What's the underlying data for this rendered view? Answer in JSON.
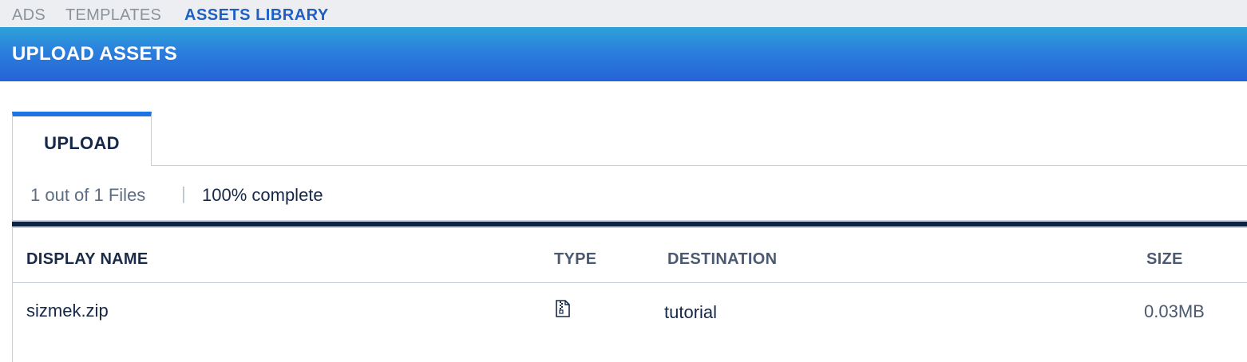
{
  "topnav": {
    "items": [
      {
        "label": "ADS"
      },
      {
        "label": "TEMPLATES"
      },
      {
        "label": "ASSETS LIBRARY",
        "active": true
      }
    ]
  },
  "header": {
    "title": "UPLOAD ASSETS"
  },
  "tabs": [
    {
      "label": "UPLOAD",
      "active": true
    }
  ],
  "status": {
    "files_text": "1 out of 1 Files",
    "separator": "|",
    "complete_text": "100% complete",
    "progress_fraction": 1.0
  },
  "table": {
    "columns": [
      "DISPLAY NAME",
      "TYPE",
      "DESTINATION",
      "SIZE"
    ],
    "rows": [
      {
        "display_name": "sizmek.zip",
        "type_icon": "zip-file-icon",
        "destination": "tutorial",
        "size": "0.03MB"
      }
    ]
  },
  "colors": {
    "accent": "#1f74e5",
    "active_nav": "#1f5fc4",
    "header_gradient_start": "#2ea2d9",
    "header_gradient_end": "#2563d6",
    "progress_fill": "#0e2244"
  }
}
